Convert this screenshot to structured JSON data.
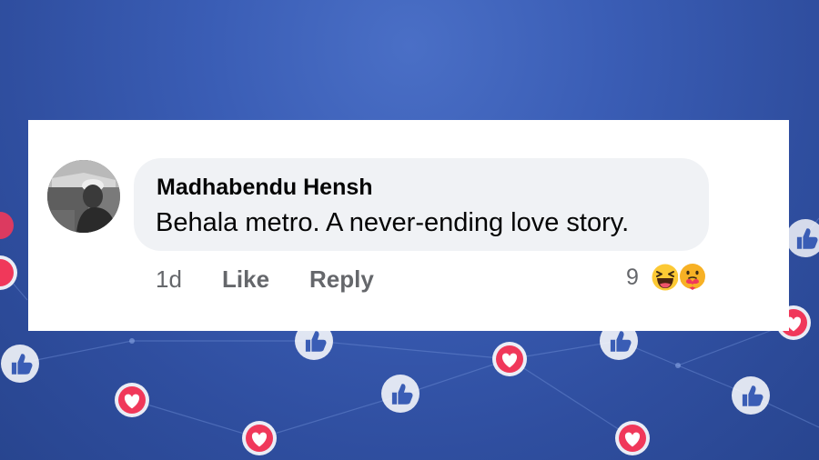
{
  "comment": {
    "author": "Madhabendu Hensh",
    "text": "Behala metro. A never-ending love story.",
    "time": "1d",
    "like_label": "Like",
    "reply_label": "Reply",
    "reaction_count": "9",
    "reactions": [
      "haha-icon",
      "care-icon"
    ]
  },
  "colors": {
    "background": "#3a5db5",
    "card": "#ffffff",
    "bubble": "#f0f2f5",
    "text_primary": "#050505",
    "text_secondary": "#65676b",
    "like_icon_bg": "#ffffff",
    "love_icon_bg": "#f0385a"
  }
}
